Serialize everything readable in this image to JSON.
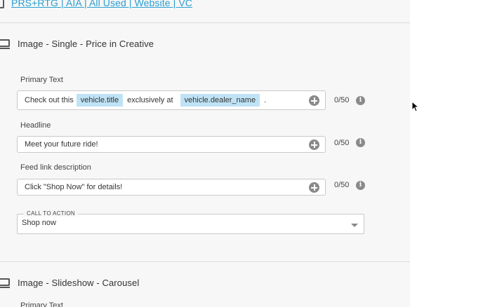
{
  "top_link": {
    "text": "PRS+RTG | AIA | All Used | Website | VC",
    "icon": "document-icon"
  },
  "sections": [
    {
      "title": "Image - Single - Price in Creative",
      "icon": "monitor-icon",
      "fields": {
        "primary_text": {
          "label": "Primary Text",
          "segments": [
            "Check out this",
            "vehicle.title",
            "exclusively at",
            "vehicle.dealer_name",
            "."
          ],
          "counter": "0/50"
        },
        "headline": {
          "label": "Headline",
          "value": "Meet your future ride!",
          "counter": "0/50"
        },
        "feed_link_description": {
          "label": "Feed link description",
          "value": "Click \"Shop Now\" for details!",
          "counter": "0/50"
        },
        "call_to_action": {
          "label": "CALL TO ACTION",
          "value": "Shop now"
        }
      }
    },
    {
      "title": "Image - Slideshow - Carousel",
      "icon": "monitor-icon",
      "fields": {
        "primary_text": {
          "label": "Primary Text"
        }
      }
    }
  ],
  "info_icon_glyph": "i",
  "colors": {
    "link": "#2a9fd0",
    "tag_background": "#bfe3f5",
    "panel_background": "#f7f7f7",
    "icon_gray": "#8a8a8a"
  }
}
